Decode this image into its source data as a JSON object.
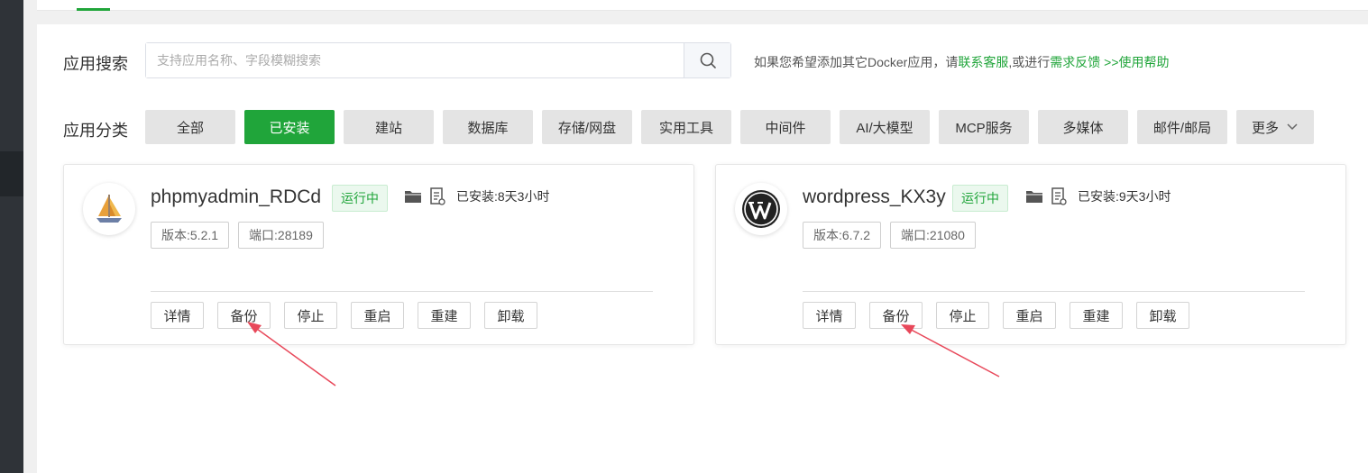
{
  "search": {
    "label": "应用搜索",
    "placeholder": "支持应用名称、字段模糊搜索",
    "icon": "search-icon"
  },
  "help": {
    "prefix": "如果您希望添加其它Docker应用，请",
    "contact": "联系客服",
    "middle": ",或进行",
    "feedback": "需求反馈",
    "arrows": " >>",
    "help_link": "使用帮助"
  },
  "categories": {
    "label": "应用分类",
    "items": [
      "全部",
      "已安装",
      "建站",
      "数据库",
      "存储/网盘",
      "实用工具",
      "中间件",
      "AI/大模型",
      "MCP服务",
      "多媒体",
      "邮件/邮局"
    ],
    "active": "已安装",
    "more": "更多"
  },
  "apps": [
    {
      "name": "phpmyadmin_RDCd",
      "status": "运行中",
      "installed": "已安装:8天3小时",
      "version": "版本:5.2.1",
      "port": "端口:28189",
      "logo_icon": "phpmyadmin-sailboat-icon"
    },
    {
      "name": "wordpress_KX3y",
      "status": "运行中",
      "installed": "已安装:9天3小时",
      "version": "版本:6.7.2",
      "port": "端口:21080",
      "logo_icon": "wordpress-logo-icon"
    }
  ],
  "actions": [
    "详情",
    "备份",
    "停止",
    "重启",
    "重建",
    "卸载"
  ],
  "colors": {
    "accent": "#20a53a",
    "annotation_arrow": "#e8485a",
    "sidebar": "#2f3338"
  }
}
